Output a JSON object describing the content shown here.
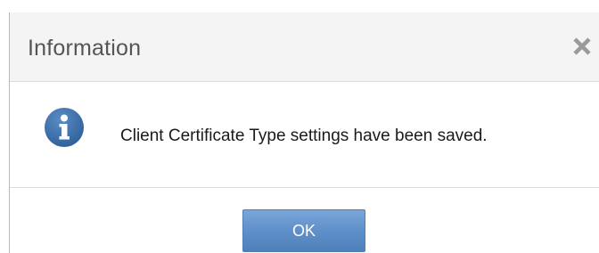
{
  "dialog": {
    "title": "Information",
    "close_icon": "close-icon",
    "info_icon": "info-icon",
    "message": "Client Certificate Type settings have been saved.",
    "ok_label": "OK",
    "colors": {
      "header_bg": "#f4f4f4",
      "title_text": "#555555",
      "icon_blue": "#3a6ea8",
      "button_blue": "#5f90c9"
    }
  }
}
